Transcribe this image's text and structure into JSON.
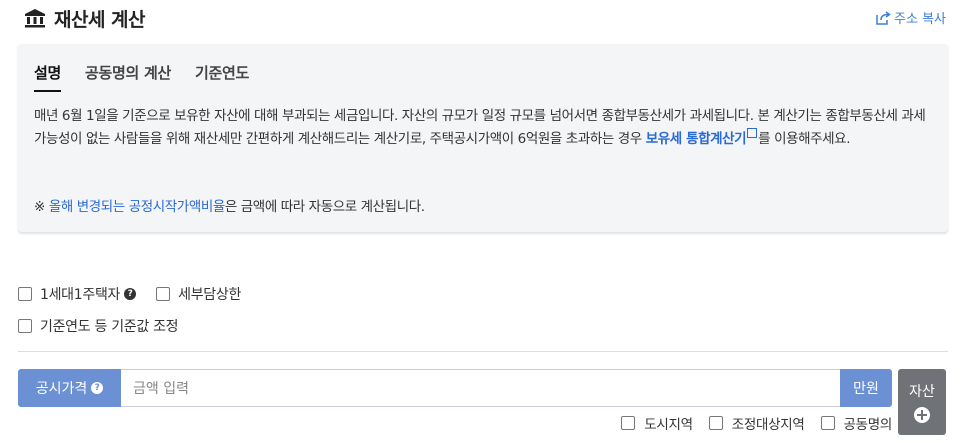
{
  "header": {
    "icon": "bank-icon",
    "title": "재산세 계산",
    "copy_link_icon": "share-icon",
    "copy_link_label": "주소 복사"
  },
  "info": {
    "tabs": [
      {
        "label": "설명",
        "active": true
      },
      {
        "label": "공동명의 계산",
        "active": false
      },
      {
        "label": "기준연도",
        "active": false
      }
    ],
    "description_part1": "매년 6월 1일을 기준으로 보유한 자산에 대해 부과되는 세금입니다. 자산의 규모가 일정 규모를 넘어서면 종합부동산세가 과세됩니다. 본 계산기는 종합부동산세 과세 가능성이 없는 사람들을 위해 재산세만 간편하게 계산해드리는 계산기로, 주택공시가액이 6억원을 초과하는 경우 ",
    "description_link": "보유세 통합계산기",
    "description_part2": "를 이용해주세요.",
    "note_prefix": "※ ",
    "note_link": "올해 변경되는 공정시작가액비율",
    "note_suffix": "은 금액에 따라 자동으로 계산됩니다."
  },
  "options": {
    "one_house": "1세대1주택자",
    "tax_burden_cap": "세부담상한",
    "base_year_adjust": "기준연도 등 기준값 조정"
  },
  "price": {
    "label": "공시가격",
    "placeholder": "금액 입력",
    "unit": "만원"
  },
  "asset_button": {
    "label": "자산",
    "icon": "plus-circle-icon"
  },
  "asset_options": {
    "urban": "도시지역",
    "regulated": "조정대상지역",
    "joint": "공동명의"
  },
  "colors": {
    "accent": "#6b91d4",
    "link": "#2a6ad4",
    "asset_button": "#6f7378"
  }
}
